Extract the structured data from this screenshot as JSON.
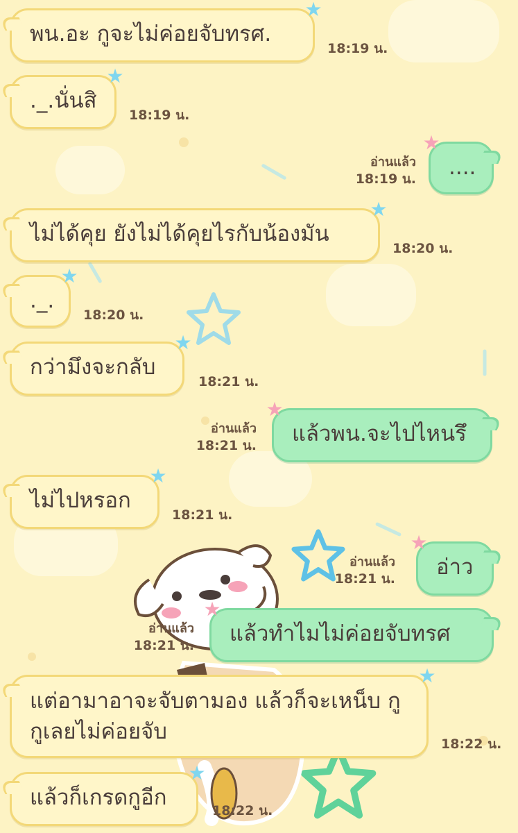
{
  "chat": {
    "read_label": "อ่านแล้ว",
    "messages": [
      {
        "side": "in",
        "text": "พน.อะ กูจะไม่ค่อยจับทรศ.",
        "time": "18:19 น."
      },
      {
        "side": "in",
        "text": "._.นั่นสิ",
        "time": "18:19 น."
      },
      {
        "side": "out",
        "text": "....",
        "time": "18:19 น.",
        "read": true
      },
      {
        "side": "in",
        "text": "ไม่ได้คุย ยังไม่ได้คุยไรกับน้องมัน",
        "time": "18:20 น."
      },
      {
        "side": "in",
        "text": "._.",
        "time": "18:20 น."
      },
      {
        "side": "in",
        "text": "กว่ามึงจะกลับ",
        "time": "18:21 น."
      },
      {
        "side": "out",
        "text": "แล้วพน.จะไปไหนรึ",
        "time": "18:21 น.",
        "read": true
      },
      {
        "side": "in",
        "text": "ไม่ไปหรอก",
        "time": "18:21 น."
      },
      {
        "side": "out",
        "text": "อ่าว",
        "time": "18:21 น.",
        "read": true
      },
      {
        "side": "out",
        "text": "แล้วทำไมไม่ค่อยจับทรศ",
        "time": "18:21 น.",
        "read": true
      },
      {
        "side": "in",
        "text": "แต่อามาอาจะจับตามอง แล้วก็จะเหน็บ กู กูเลยไม่ค่อยจับ",
        "time": "18:22 น."
      },
      {
        "side": "in",
        "text": "แล้วก็เกรดกูอีก",
        "time": "18:22 น."
      }
    ]
  },
  "colors": {
    "background": "#fdf3c4",
    "incoming_bubble": "#fff6c9",
    "outgoing_bubble": "#a9eebd",
    "star_incoming": "#7fd6ef",
    "star_outgoing": "#f6a3b8"
  },
  "icons": {
    "bubble_star": "star-icon",
    "wallpaper_character": "puppy-sticker"
  }
}
